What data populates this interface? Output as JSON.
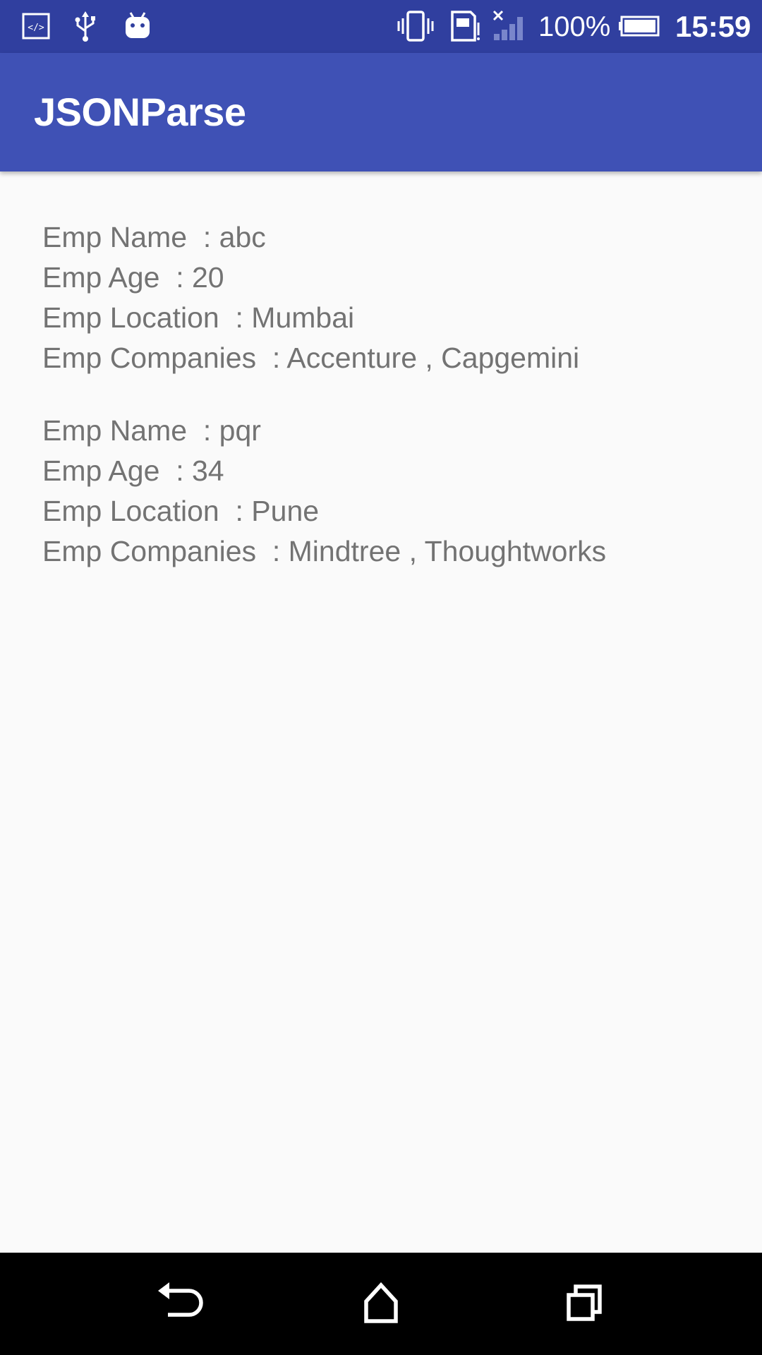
{
  "status_bar": {
    "battery_percent": "100%",
    "time": "15:59",
    "icons": [
      "code-icon",
      "usb-icon",
      "android-icon",
      "vibrate-icon",
      "sim-alert-icon",
      "signal-icon",
      "battery-icon"
    ]
  },
  "app_bar": {
    "title": "JSONParse"
  },
  "employees": [
    {
      "name_label": "Emp Name",
      "name_value": ": abc",
      "age_label": "Emp Age",
      "age_value": ": 20",
      "location_label": "Emp Location",
      "location_value": ": Mumbai",
      "companies_label": "Emp Companies",
      "companies_value": ": Accenture , Capgemini"
    },
    {
      "name_label": "Emp Name",
      "name_value": ": pqr",
      "age_label": "Emp Age",
      "age_value": ": 34",
      "location_label": "Emp Location",
      "location_value": ": Pune",
      "companies_label": "Emp Companies",
      "companies_value": ": Mindtree , Thoughtworks"
    }
  ],
  "nav_bar": {
    "icons": [
      "back-icon",
      "home-icon",
      "recents-icon"
    ]
  },
  "colors": {
    "status_bar": "#303f9f",
    "app_bar": "#3f51b5",
    "background": "#fafafa",
    "text": "#737373",
    "nav_bar": "#000000"
  }
}
